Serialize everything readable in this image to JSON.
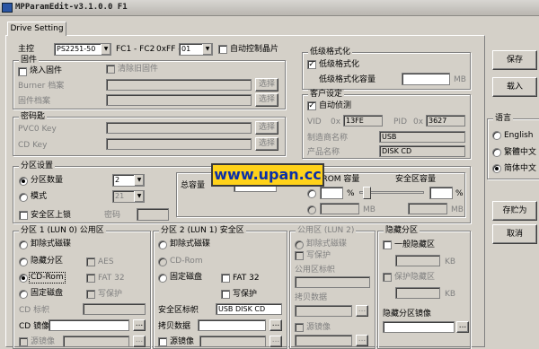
{
  "window": {
    "title": "MPParamEdit-v3.1.0.0 F1"
  },
  "tab": "Drive Setting",
  "controller": {
    "label": "主控",
    "chip": "PS2251-50",
    "fc": "FC1 - FC2",
    "fc_prefix": "0xFF -",
    "fc_value": "01",
    "auto_checkbox": "自动控制晶片"
  },
  "firmware": {
    "title": "固件",
    "load_firmware": "烧入固件",
    "clear_firmware": "清除旧固件",
    "burner_file": "Burner 档案",
    "firmware_file": "固件档案",
    "browse": "选择"
  },
  "password": {
    "title": "密码匙",
    "pvc0": "PVC0 Key",
    "cd_key": "CD Key",
    "browse": "选择"
  },
  "lowlevel": {
    "title": "低级格式化",
    "enable": "低级格式化",
    "capacity_label": "低级格式化容量",
    "unit": "MB"
  },
  "customer": {
    "title": "客户设定",
    "auto_detect": "自动侦测",
    "vid_label": "VID",
    "vid_prefix": "0x",
    "vid": "13FE",
    "pid_label": "PID",
    "pid_prefix": "0x",
    "pid": "3627",
    "vendor_label": "制造商名称",
    "vendor": "USB",
    "product_label": "产品名称",
    "product": "DISK CD"
  },
  "buttons": {
    "save": "保存",
    "load": "载入",
    "save_as": "存贮为",
    "cancel": "取消"
  },
  "language": {
    "title": "语言",
    "options": [
      "English",
      "繁體中文",
      "简体中文"
    ],
    "selected": 2
  },
  "partition": {
    "title": "分区设置",
    "count_label": "分区数量",
    "count": "2",
    "mode_label": "模式",
    "mode_value": "21",
    "security_upload": "安全区上锁",
    "password_label": "密码",
    "total_label": "总容量",
    "cdrom_label": "CD-ROM 容量",
    "secure_label": "安全区容量",
    "pct": "%",
    "mb": "MB"
  },
  "banner": "www.upan.cc",
  "lun0": {
    "title": "分区 1 (LUN 0) 公用区",
    "removable": "卸除式磁碟",
    "hidden": "隐藏分区",
    "cdrom": "CD-Rom",
    "fixed": "固定磁盘",
    "aes": "AES",
    "fat32": "FAT 32",
    "write_protect": "写保护",
    "cd_label_lbl": "CD 标帜",
    "cd_image_lbl": "CD 镜像",
    "source_image_lbl": "源镜像",
    "browse": "..."
  },
  "lun1": {
    "title": "分区 2 (LUN 1) 安全区",
    "removable": "卸除式磁碟",
    "cdrom": "CD-Rom",
    "fixed": "固定磁盘",
    "fat32": "FAT 32",
    "write_protect": "写保护",
    "secure_label_lbl": "安全区标帜",
    "secure_label": "USB DISK CD",
    "copy_data": "拷贝数据",
    "source_image_lbl": "源镜像",
    "browse": "..."
  },
  "lun2": {
    "title": "公用区 (LUN 2)",
    "removable": "卸除式磁碟",
    "write_protect": "写保护",
    "public_label_lbl": "公用区标帜",
    "copy_data": "拷贝数据",
    "source_image_lbl": "源镜像",
    "browse": "..."
  },
  "hidden": {
    "title": "隐藏分区",
    "general_hidden": "一般隐藏区",
    "kb": "KB",
    "protect_hidden": "保护隐藏区",
    "image_lbl": "隐藏分区镜像",
    "browse": "..."
  }
}
